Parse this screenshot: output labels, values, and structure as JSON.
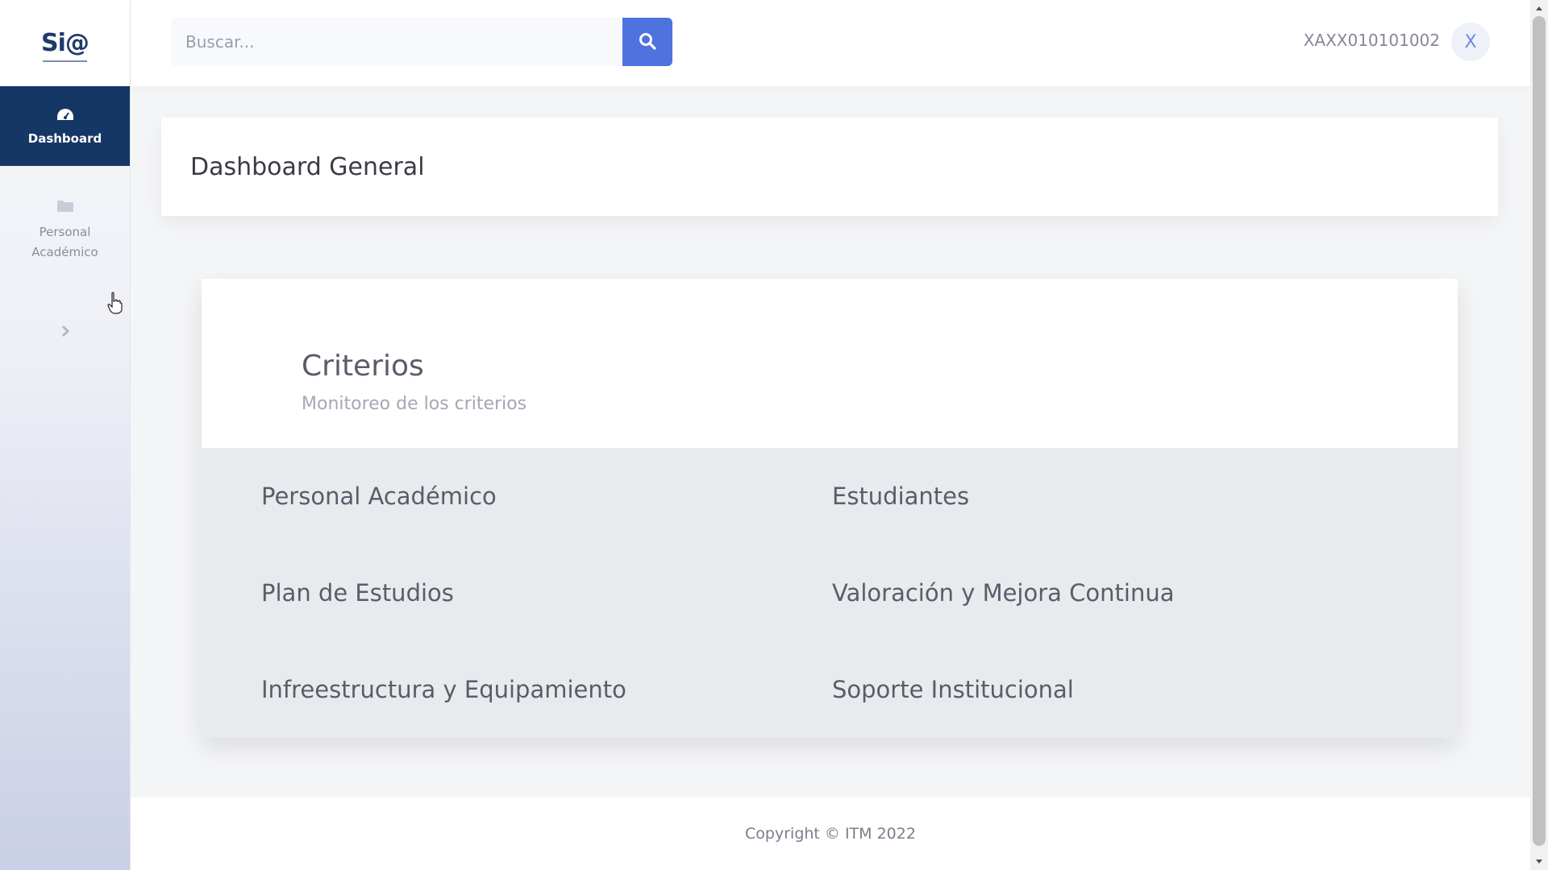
{
  "brand": {
    "logo_text": "Si@"
  },
  "sidebar": {
    "items": [
      {
        "label": "Dashboard",
        "icon": "tachometer-icon",
        "active": true
      },
      {
        "label": "Personal Académico",
        "icon": "folder-icon",
        "active": false
      }
    ],
    "toggle_icon": "chevron-right-icon"
  },
  "topbar": {
    "search": {
      "placeholder": "Buscar...",
      "value": ""
    },
    "search_icon": "search-icon",
    "user_name": "XAXX010101002",
    "avatar_letter": "X"
  },
  "page": {
    "title": "Dashboard General"
  },
  "criterios": {
    "title": "Criterios",
    "subtitle": "Monitoreo de los criterios",
    "items": [
      "Personal Académico",
      "Estudiantes",
      "Plan de Estudios",
      "Valoración y Mejora Continua",
      "Infreestructura y Equipamiento",
      "Soporte Institucional"
    ]
  },
  "footer": {
    "text": "Copyright © ITM 2022"
  },
  "colors": {
    "primary": "#4e73df",
    "sidebar_active": "#153765",
    "text_muted": "#858796"
  }
}
